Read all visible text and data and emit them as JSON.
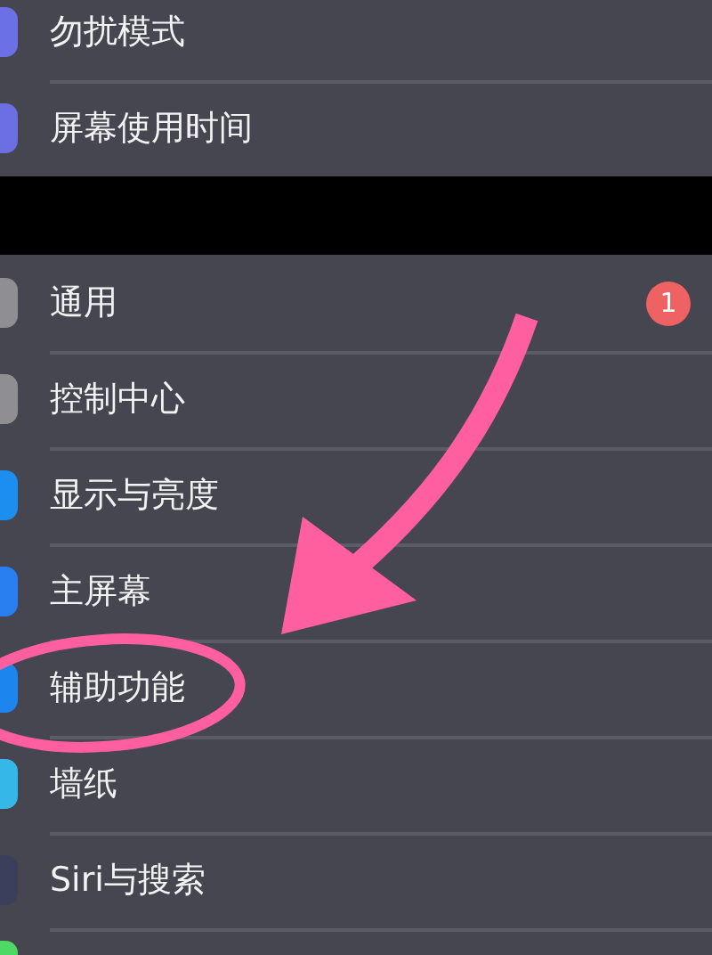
{
  "groups": [
    {
      "items": [
        {
          "label": "勿扰模式",
          "color": "#6b70e6"
        },
        {
          "label": "屏幕使用时间",
          "color": "#6c6fe2"
        }
      ]
    },
    {
      "items": [
        {
          "label": "通用",
          "color": "#8e8e93",
          "badge": "1"
        },
        {
          "label": "控制中心",
          "color": "#8e8e93"
        },
        {
          "label": "显示与亮度",
          "color": "#1c8ef0"
        },
        {
          "label": "主屏幕",
          "color": "#2a7ff0"
        },
        {
          "label": "辅助功能",
          "color": "#1c86ee"
        },
        {
          "label": "墙纸",
          "color": "#35b8e8"
        },
        {
          "label": "Siri与搜索",
          "color": "#3b3f5c"
        },
        {
          "color": "#4cd964"
        }
      ]
    }
  ],
  "arrow_annotation": {
    "color": "#ff5f9e"
  },
  "ellipse_annotation": {
    "color": "#ff5f9e"
  }
}
